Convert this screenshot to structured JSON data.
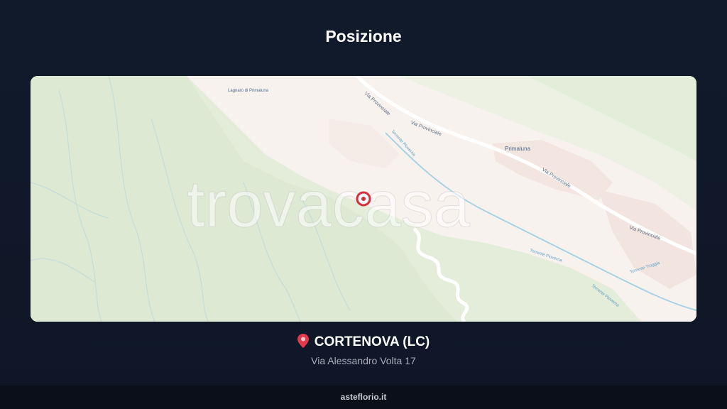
{
  "header": {
    "title": "Posizione"
  },
  "map": {
    "watermark": "trovacasa",
    "place_labels": {
      "primaluna": "Primaluna",
      "small_place": "Lagnaro di Primaluna"
    },
    "road_labels": {
      "road1": "Via Provinciale",
      "road2": "Via Provinciale",
      "road3": "Via Provinciale",
      "road4": "Via Provinciale"
    },
    "river_labels": {
      "river1": "Torrente Pioverna",
      "river2": "Torrente Pioverna",
      "river3": "Torrente Troggia",
      "river4": "Torrente Pioverna"
    },
    "marker_color": "#d92c3a"
  },
  "location": {
    "pin_icon": "map-pin-icon",
    "city": "CORTENOVA (LC)",
    "address": "Via Alessandro Volta 17"
  },
  "footer": {
    "site": "asteflorio.it"
  }
}
